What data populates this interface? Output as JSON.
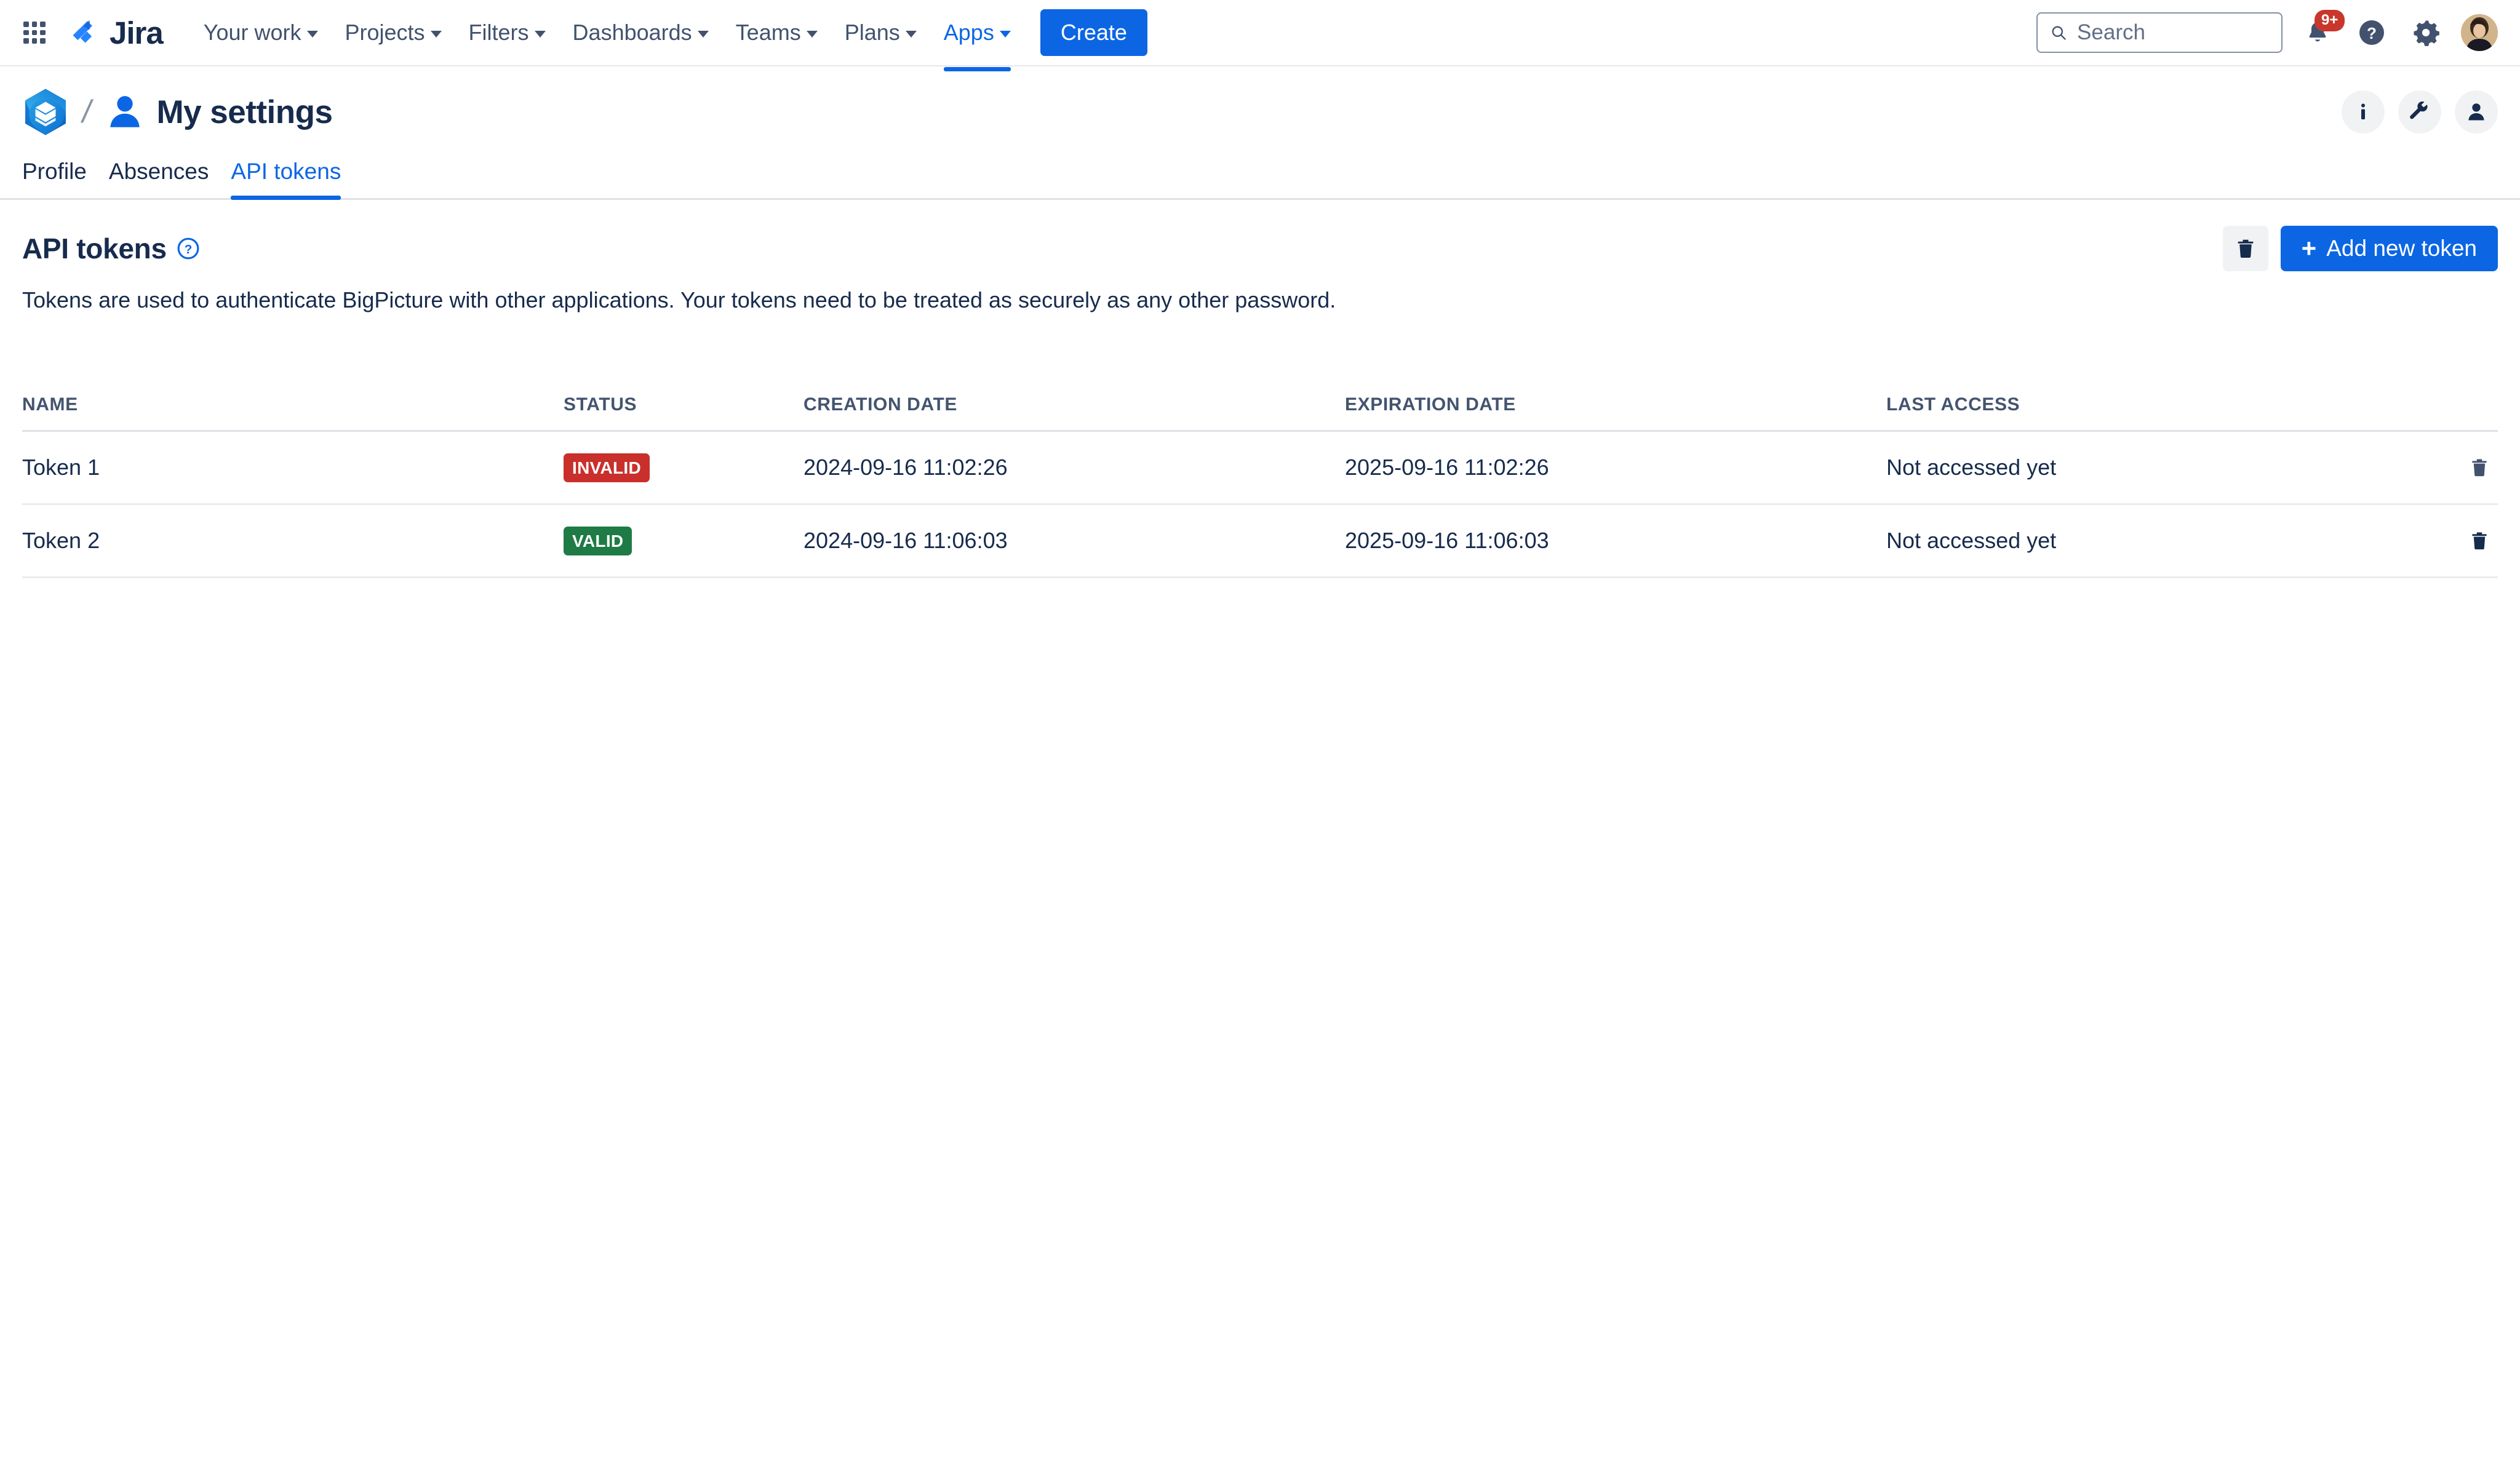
{
  "topnav": {
    "app_switcher_icon": "grid-apps-icon",
    "product_name": "Jira",
    "menu": [
      {
        "label": "Your work",
        "has_caret": true,
        "active": false
      },
      {
        "label": "Projects",
        "has_caret": true,
        "active": false
      },
      {
        "label": "Filters",
        "has_caret": true,
        "active": false
      },
      {
        "label": "Dashboards",
        "has_caret": true,
        "active": false
      },
      {
        "label": "Teams",
        "has_caret": true,
        "active": false
      },
      {
        "label": "Plans",
        "has_caret": true,
        "active": false
      },
      {
        "label": "Apps",
        "has_caret": true,
        "active": true
      }
    ],
    "create_label": "Create",
    "search_placeholder": "Search",
    "search_value": "",
    "notification_count": "9+",
    "icons": {
      "search": "search-icon",
      "notifications": "bell-icon",
      "help": "help-circle-icon",
      "settings": "gear-icon",
      "profile": "user-avatar"
    },
    "colors": {
      "accent": "#0C66E4",
      "badge": "#C9372C",
      "text": "#42526E"
    }
  },
  "page_header": {
    "app_logo": "bigpicture-logo",
    "separator": "/",
    "avatar_icon": "person-icon",
    "title": "My settings",
    "actions": [
      {
        "name": "info-button",
        "icon": "info-icon"
      },
      {
        "name": "tools-button",
        "icon": "wrench-icon"
      },
      {
        "name": "account-button",
        "icon": "person-icon"
      }
    ]
  },
  "tabs": [
    {
      "label": "Profile",
      "active": false
    },
    {
      "label": "Absences",
      "active": false
    },
    {
      "label": "API tokens",
      "active": true
    }
  ],
  "section": {
    "title": "API tokens",
    "help_icon": "question-circle-icon",
    "description": "Tokens are used to authenticate BigPicture with other applications. Your tokens need to be treated as securely as any other password.",
    "delete_icon": "trash-icon",
    "add_label": "Add new token",
    "add_plus": "+"
  },
  "table": {
    "columns": [
      "NAME",
      "STATUS",
      "CREATION DATE",
      "EXPIRATION DATE",
      "LAST ACCESS"
    ],
    "rows": [
      {
        "name": "Token 1",
        "status": "INVALID",
        "status_kind": "invalid",
        "creation_date": "2024-09-16 11:02:26",
        "expiration_date": "2025-09-16 11:02:26",
        "last_access": "Not accessed yet",
        "delete_icon": "trash-icon"
      },
      {
        "name": "Token 2",
        "status": "VALID",
        "status_kind": "valid",
        "creation_date": "2024-09-16 11:06:03",
        "expiration_date": "2025-09-16 11:06:03",
        "last_access": "Not accessed yet",
        "delete_icon": "trash-icon"
      }
    ],
    "status_colors": {
      "invalid": "#C9302C",
      "valid": "#1E7B45"
    }
  }
}
